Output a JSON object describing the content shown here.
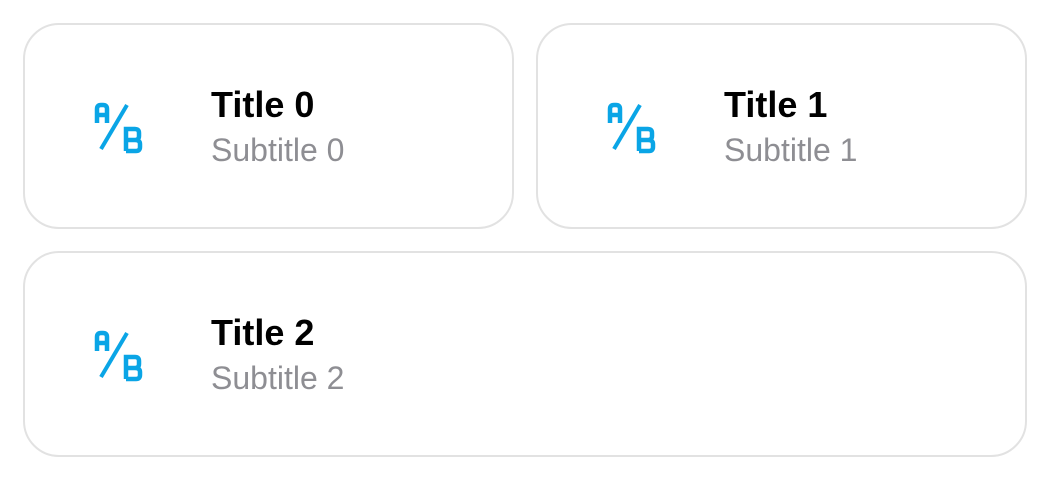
{
  "accent_color": "#0aa5e6",
  "cards": [
    {
      "icon": "ab-test-icon",
      "title": "Title 0",
      "subtitle": "Subtitle 0"
    },
    {
      "icon": "ab-test-icon",
      "title": "Title 1",
      "subtitle": "Subtitle 1"
    },
    {
      "icon": "ab-test-icon",
      "title": "Title 2",
      "subtitle": "Subtitle 2"
    }
  ]
}
